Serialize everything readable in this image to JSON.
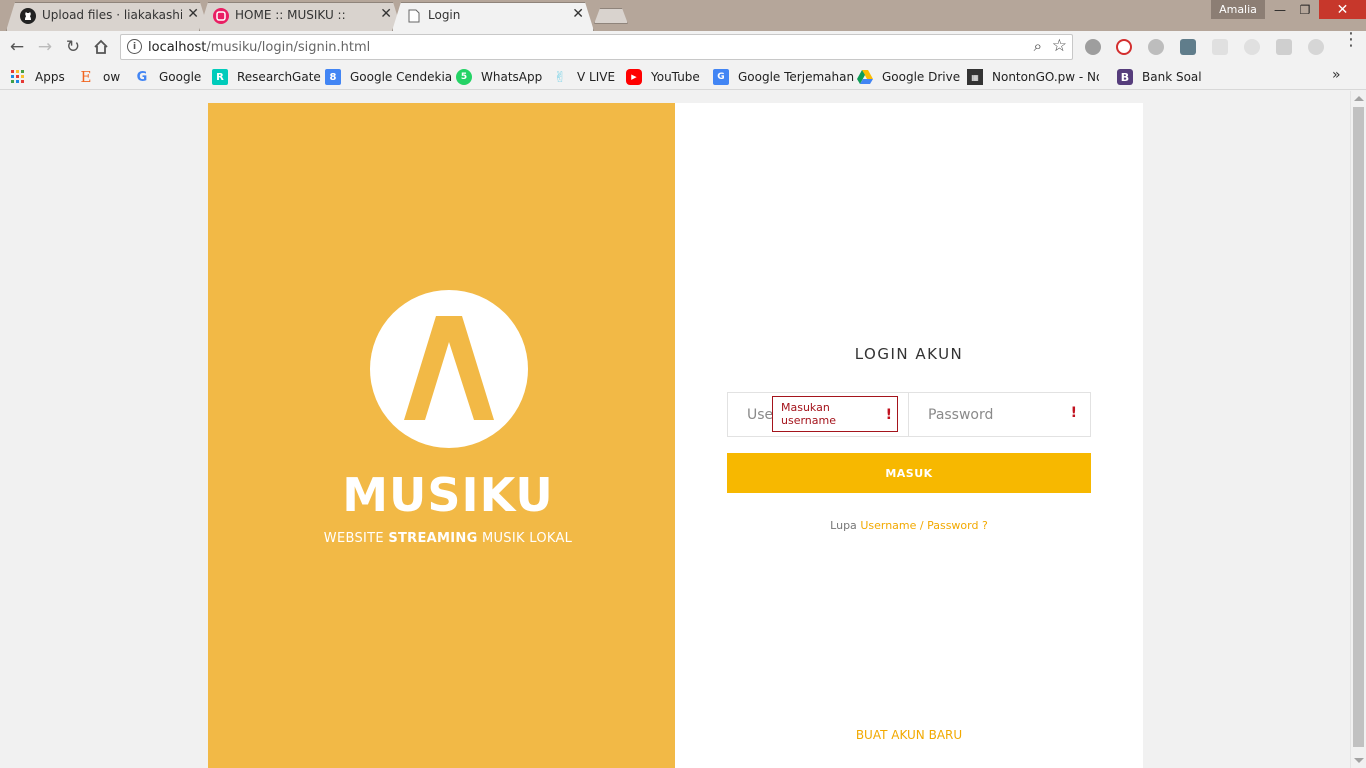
{
  "tabs": [
    {
      "label": "Upload files · liakakashi/A",
      "icon": "github-icon"
    },
    {
      "label": "HOME :: MUSIKU ::",
      "icon": "musiku-icon"
    },
    {
      "label": "Login",
      "icon": "page-icon"
    }
  ],
  "window": {
    "user": "Amalia"
  },
  "address": {
    "host": "localhost",
    "path": "/musiku/login/signin.html"
  },
  "bookmarks": [
    {
      "label": "Apps",
      "icon": "apps-grid-icon",
      "color": "#4285f4"
    },
    {
      "label": "ow",
      "icon": "etsy-icon",
      "color": "#f1641e"
    },
    {
      "label": "Google",
      "icon": "google-icon",
      "color": "#4285f4"
    },
    {
      "label": "ResearchGate",
      "icon": "researchgate-icon",
      "color": "#00ccbb"
    },
    {
      "label": "Google Cendekia",
      "icon": "scholar-icon",
      "color": "#4285f4"
    },
    {
      "label": "WhatsApp",
      "icon": "whatsapp-icon",
      "color": "#25d366"
    },
    {
      "label": "V LIVE",
      "icon": "vlive-icon",
      "color": "#7fd4e8"
    },
    {
      "label": "YouTube",
      "icon": "youtube-icon",
      "color": "#ff0000"
    },
    {
      "label": "Google Terjemahan",
      "icon": "translate-icon",
      "color": "#4285f4"
    },
    {
      "label": "Google Drive",
      "icon": "drive-icon",
      "color": "#0f9d58"
    },
    {
      "label": "NontonGO.pw - Non",
      "icon": "film-icon",
      "color": "#333333"
    },
    {
      "label": "Bank Soal",
      "icon": "bootstrap-icon",
      "color": "#563d7c"
    }
  ],
  "brand": {
    "name": "MUSIKU",
    "tagline_pre": "WEBSITE ",
    "tagline_bold": "STREAMING",
    "tagline_post": " MUSIK LOKAL",
    "color": "#f2b946"
  },
  "login": {
    "title": "LOGIN AKUN",
    "username_placeholder": "Username",
    "password_placeholder": "Password",
    "validation_message": "Masukan username",
    "submit_label": "MASUK",
    "forgot_prefix": "Lupa ",
    "forgot_link": "Username / Password ?",
    "create_account": "BUAT AKUN BARU",
    "accent_color": "#f7b800"
  }
}
